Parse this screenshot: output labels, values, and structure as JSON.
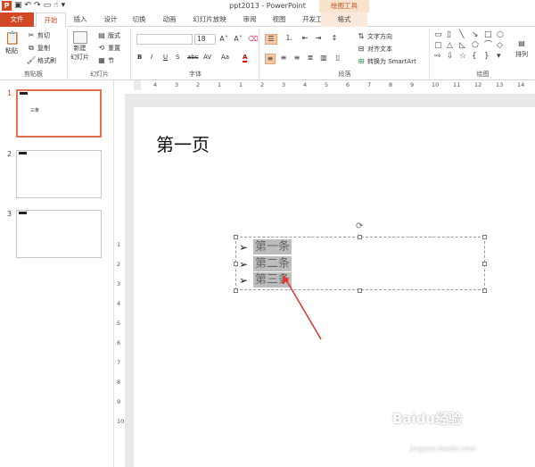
{
  "window": {
    "doc_title": "ppt2013 - PowerPoint",
    "contextual_tab_header": "绘图工具",
    "app_icon": "P"
  },
  "tabs": [
    "文件",
    "开始",
    "插入",
    "设计",
    "切换",
    "动画",
    "幻灯片放映",
    "审阅",
    "视图",
    "开发工具",
    "格式"
  ],
  "ribbon": {
    "clipboard": {
      "label": "剪贴板",
      "paste": "粘贴",
      "cut": "剪切",
      "copy": "复制",
      "format_painter": "格式刷"
    },
    "slides": {
      "label": "幻灯片",
      "new_slide_line1": "新建",
      "new_slide_line2": "幻灯片",
      "layout": "版式",
      "reset": "重置",
      "section": "节"
    },
    "font": {
      "label": "字体",
      "font_name": "",
      "font_size": "18",
      "bold": "B",
      "italic": "I",
      "underline": "U",
      "shadow": "S",
      "strike": "abc",
      "spacing": "AV",
      "case": "Aa",
      "font_color": "A"
    },
    "paragraph": {
      "label": "段落",
      "text_direction": "文字方向",
      "align_text": "对齐文本",
      "smartart": "转换为 SmartArt"
    },
    "drawing": {
      "label": "绘图",
      "arrange": "排列"
    }
  },
  "ruler": {
    "h_ticks": [
      "4",
      "3",
      "2",
      "1",
      "1",
      "2",
      "3",
      "4",
      "5",
      "6",
      "7",
      "8",
      "9",
      "10",
      "11",
      "12",
      "13",
      "14"
    ],
    "v_ticks": [
      "1",
      "2",
      "3",
      "4",
      "5",
      "6",
      "7",
      "8",
      "9",
      "10"
    ]
  },
  "slides_pane": {
    "slides": [
      {
        "num": "1",
        "active": true,
        "body": "三条"
      },
      {
        "num": "2",
        "active": false,
        "body": ""
      },
      {
        "num": "3",
        "active": false,
        "body": ""
      }
    ]
  },
  "slide": {
    "title": "第一页",
    "bullets": [
      "第一条",
      "第二条",
      "第三条"
    ],
    "bullet_symbol": "➢"
  },
  "annotation": {
    "arrow_color": "#e8312b"
  },
  "watermark": {
    "brand": "Baidu经验",
    "url": "jingyan.baidu.com"
  }
}
